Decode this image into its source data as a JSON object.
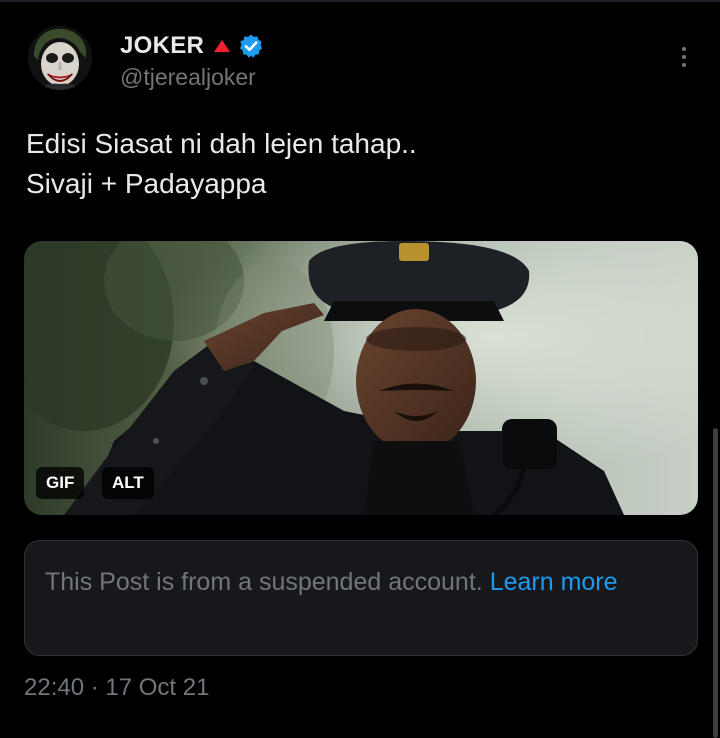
{
  "author": {
    "display_name": "JOKER",
    "handle": "@tjerealjoker",
    "avatar_icon": "joker-avatar",
    "badge_icon": "red-triangle-icon",
    "verified_icon": "verified-badge-icon",
    "verified_color": "#1d9bf0"
  },
  "tweet": {
    "line1": "Edisi Siasat ni dah lejen tahap..",
    "line2": "Sivaji + Padayappa"
  },
  "media": {
    "gif_label": "GIF",
    "alt_label": "ALT"
  },
  "notice": {
    "text": "This Post is from a suspended account.",
    "link": "Learn more",
    "link_color": "#1d9bf0"
  },
  "meta": {
    "timestamp": "22:40 · 17 Oct 21"
  },
  "colors": {
    "background": "#000000",
    "text": "#e7e9ea",
    "muted": "#71767b",
    "accent": "#1d9bf0"
  }
}
